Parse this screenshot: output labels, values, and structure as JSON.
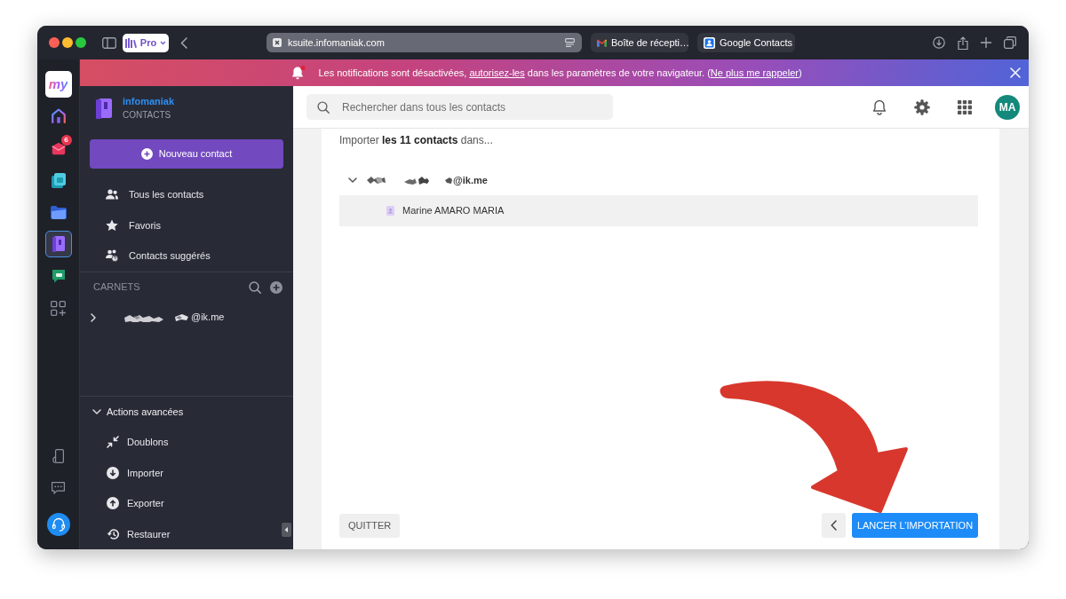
{
  "browser": {
    "profile": "Pro",
    "url": "ksuite.infomaniak.com",
    "tabs": [
      {
        "kind": "mail",
        "label": "Boîte de récepti…"
      },
      {
        "kind": "contacts",
        "label": "Google Contacts"
      }
    ]
  },
  "notification": {
    "parts": [
      {
        "kind": "text",
        "text": "Les notifications sont désactivées, "
      },
      {
        "kind": "link",
        "text": "autorisez-les"
      },
      {
        "kind": "text",
        "text": " dans les paramètres de votre navigateur. ("
      },
      {
        "kind": "link",
        "text": "Ne plus me rappeler"
      },
      {
        "kind": "text",
        "text": ")"
      }
    ]
  },
  "app_rail": {
    "items": [
      {
        "kind": "logo",
        "text": "my",
        "selected": false
      },
      {
        "kind": "home",
        "selected": false
      },
      {
        "kind": "mail",
        "badge": "6",
        "selected": false
      },
      {
        "kind": "calendar",
        "selected": false
      },
      {
        "kind": "drive",
        "selected": false
      },
      {
        "kind": "contacts",
        "selected": true
      },
      {
        "kind": "chat",
        "selected": false
      },
      {
        "kind": "apps",
        "selected": false
      }
    ],
    "bottom_items": [
      {
        "kind": "device"
      },
      {
        "kind": "messages"
      },
      {
        "kind": "support"
      }
    ]
  },
  "sidebar": {
    "brand": "infomaniak",
    "product": "CONTACTS",
    "new_contact_button": "Nouveau contact",
    "nav": [
      {
        "kind": "all",
        "label": "Tous les contacts"
      },
      {
        "kind": "favorites",
        "label": "Favoris"
      },
      {
        "kind": "suggested",
        "label": "Contacts suggérés"
      }
    ],
    "address_books": {
      "title": "CARNETS",
      "items": [
        {
          "label": "@ik.me",
          "redacted": true,
          "expanded": false
        }
      ]
    },
    "advanced": {
      "title": "Actions avancées",
      "expanded": true,
      "items": [
        {
          "kind": "duplicates",
          "label": "Doublons"
        },
        {
          "kind": "import",
          "label": "Importer"
        },
        {
          "kind": "export",
          "label": "Exporter"
        },
        {
          "kind": "restore",
          "label": "Restaurer"
        }
      ]
    }
  },
  "header": {
    "search": {
      "placeholder": "Rechercher dans tous les contacts"
    },
    "avatar": "MA"
  },
  "import": {
    "intro": "Importer **les 11 contacts** dans...",
    "books": [
      {
        "label": "@ik.me",
        "redacted": true,
        "expanded": true,
        "children": [
          {
            "label": "Marine AMARO MARIA",
            "selected": true
          }
        ]
      }
    ],
    "buttons": [
      {
        "kind": "quit",
        "label": "QUITTER"
      },
      {
        "kind": "back"
      },
      {
        "kind": "start",
        "label": "LANCER L’IMPORTATION"
      }
    ]
  }
}
